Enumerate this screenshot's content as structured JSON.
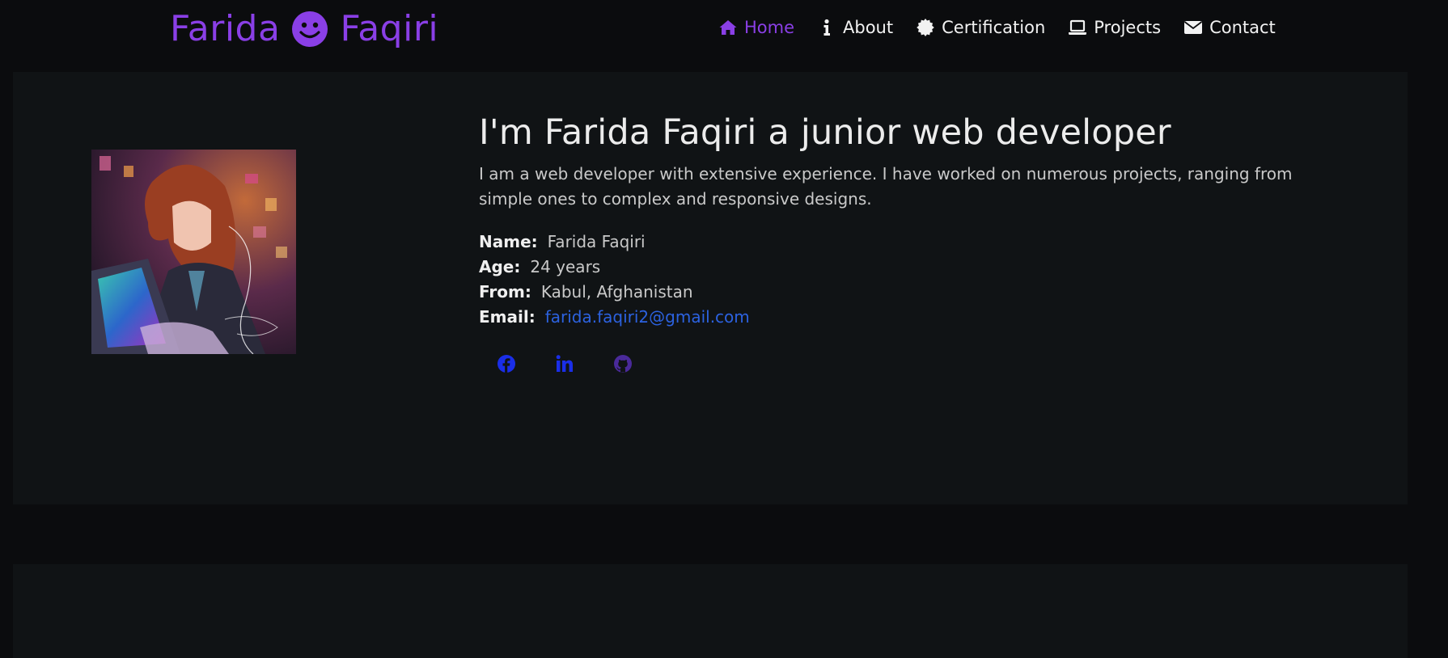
{
  "brand": {
    "first": "Farida",
    "last": "Faqiri",
    "icon": "smile-icon",
    "color": "#8a3fe6"
  },
  "nav": {
    "items": [
      {
        "label": "Home",
        "icon": "home-icon",
        "active": true
      },
      {
        "label": "About",
        "icon": "info-icon",
        "active": false
      },
      {
        "label": "Certification",
        "icon": "certificate-icon",
        "active": false
      },
      {
        "label": "Projects",
        "icon": "laptop-icon",
        "active": false
      },
      {
        "label": "Contact",
        "icon": "envelope-icon",
        "active": false
      }
    ]
  },
  "hero": {
    "headline": "I'm Farida Faqiri a junior web developer",
    "intro": "I am a web developer with extensive experience. I have worked on numerous projects, ranging from simple ones to complex and responsive designs.",
    "info": [
      {
        "label": "Name:",
        "value": "Farida Faqiri"
      },
      {
        "label": "Age:",
        "value": "24 years"
      },
      {
        "label": "From:",
        "value": "Kabul, Afghanistan"
      },
      {
        "label": "Email:",
        "value": "farida.faqiri2@gmail.com"
      }
    ],
    "socials": [
      {
        "icon": "facebook-icon",
        "color": "#1a2ee8"
      },
      {
        "icon": "linkedin-icon",
        "color": "#1a2ee8"
      },
      {
        "icon": "github-icon",
        "color": "#4a2a9a"
      }
    ]
  },
  "colors": {
    "background": "#0b0c0e",
    "section": "#101315",
    "accent": "#8a3fe6",
    "link": "#2c62e0"
  }
}
